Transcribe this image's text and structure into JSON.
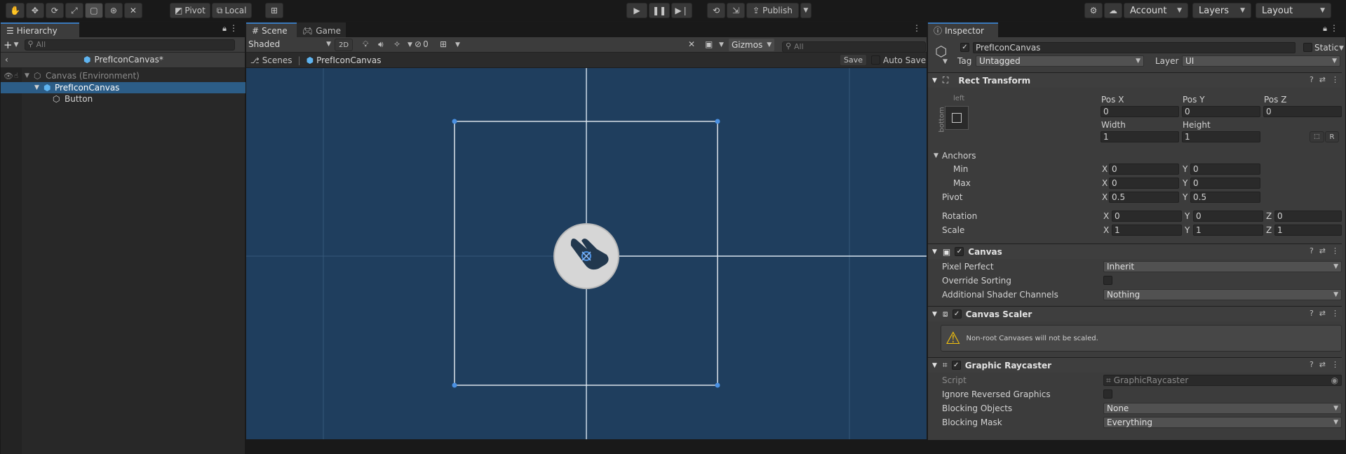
{
  "toolbar": {
    "tools": [
      "hand-tool-icon",
      "move-tool-icon",
      "rotate-tool-icon",
      "scale-tool-icon",
      "rect-tool-icon",
      "transform-tool-icon",
      "custom-tool-icon"
    ],
    "pivot_label": "Pivot",
    "local_label": "Local",
    "publish_label": "Publish",
    "account_label": "Account",
    "layers_label": "Layers",
    "layout_label": "Layout"
  },
  "hierarchy": {
    "tab_label": "Hierarchy",
    "search_placeholder": "All",
    "prefab_title": "PrefIconCanvas*",
    "items": [
      {
        "label": "Canvas (Environment)"
      },
      {
        "label": "PrefIconCanvas"
      },
      {
        "label": "Button"
      }
    ]
  },
  "scene": {
    "tabs": [
      "Scene",
      "Game"
    ],
    "shading_mode": "Shaded",
    "mode_2d": "2D",
    "hidden_count": "0",
    "gizmos_label": "Gizmos",
    "search_placeholder": "All",
    "breadcrumb_scenes": "Scenes",
    "breadcrumb_prefab": "PrefIconCanvas",
    "save_label": "Save",
    "auto_save_label": "Auto Save"
  },
  "inspector": {
    "tab_label": "Inspector",
    "object_name": "PrefIconCanvas",
    "static_label": "Static",
    "tag_label": "Tag",
    "tag_value": "Untagged",
    "layer_label": "Layer",
    "layer_value": "UI",
    "rect_transform": {
      "title": "Rect Transform",
      "anchor_h": "left",
      "anchor_v": "bottom",
      "pos_x_label": "Pos X",
      "pos_x": "0",
      "pos_y_label": "Pos Y",
      "pos_y": "0",
      "pos_z_label": "Pos Z",
      "pos_z": "0",
      "width_label": "Width",
      "width": "1",
      "height_label": "Height",
      "height": "1",
      "r_label": "R",
      "anchors_label": "Anchors",
      "min_label": "Min",
      "min_x": "0",
      "min_y": "0",
      "max_label": "Max",
      "max_x": "0",
      "max_y": "0",
      "pivot_label": "Pivot",
      "pivot_x": "0.5",
      "pivot_y": "0.5",
      "rotation_label": "Rotation",
      "rot_x": "0",
      "rot_y": "0",
      "rot_z": "0",
      "scale_label": "Scale",
      "scale_x": "1",
      "scale_y": "1",
      "scale_z": "1",
      "x": "X",
      "y": "Y",
      "z": "Z"
    },
    "canvas": {
      "title": "Canvas",
      "pixel_perfect_label": "Pixel Perfect",
      "pixel_perfect_value": "Inherit",
      "override_sorting_label": "Override Sorting",
      "shader_channels_label": "Additional Shader Channels",
      "shader_channels_value": "Nothing"
    },
    "canvas_scaler": {
      "title": "Canvas Scaler",
      "warning": "Non-root Canvases will not be scaled."
    },
    "graphic_raycaster": {
      "title": "Graphic Raycaster",
      "script_label": "Script",
      "script_value": "GraphicRaycaster",
      "ignore_reversed_label": "Ignore Reversed Graphics",
      "blocking_objects_label": "Blocking Objects",
      "blocking_objects_value": "None",
      "blocking_mask_label": "Blocking Mask",
      "blocking_mask_value": "Everything"
    }
  },
  "colors": {
    "scene_bg": "#1f3e5e",
    "selection": "#2c5d87",
    "accent": "#3a79bb"
  }
}
